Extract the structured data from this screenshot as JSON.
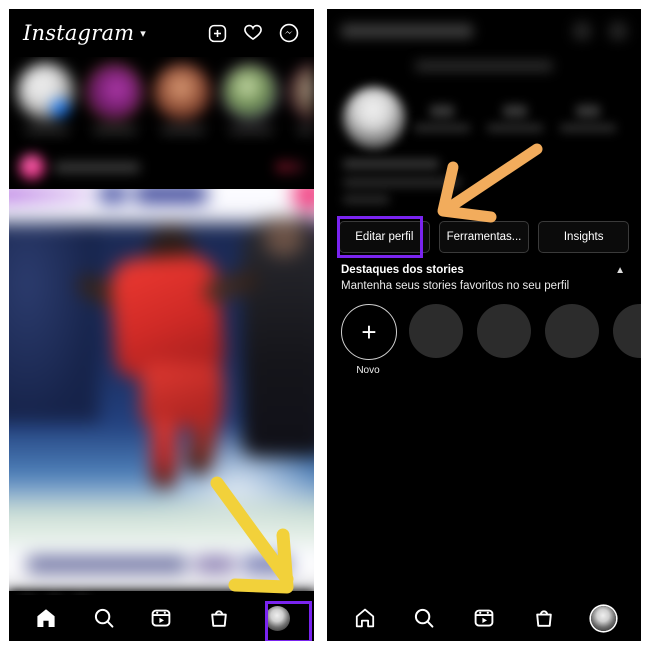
{
  "app": {
    "name": "Instagram",
    "language": "pt-BR"
  },
  "colors": {
    "highlight_box": "#7A24F0",
    "arrow_yellow": "#F2D13A",
    "arrow_orange": "#F2AC5C",
    "background": "#000000",
    "panel_border": "#ffffff"
  },
  "left_panel": {
    "name": "instagram-feed-screen",
    "header": {
      "logo_text": "Instagram",
      "logo_chevron": "chevron-down-icon",
      "icons": [
        "new-post-icon",
        "activity-heart-icon",
        "messenger-icon"
      ]
    },
    "stories": [
      {
        "label": "",
        "blurred": true
      },
      {
        "label": "",
        "blurred": true
      },
      {
        "label": "",
        "blurred": true
      },
      {
        "label": "",
        "blurred": true
      },
      {
        "label": "",
        "blurred": true
      }
    ],
    "post": {
      "author": "",
      "blurred": true,
      "image_description": "soccer player in red kit"
    },
    "annotation": {
      "arrow": "yellow-arrow-pointing-down-right",
      "target": "profile-tab"
    },
    "bottom_nav": [
      {
        "name": "home-icon",
        "label": "",
        "active": true
      },
      {
        "name": "search-icon",
        "label": "",
        "active": false
      },
      {
        "name": "reels-icon",
        "label": "",
        "active": false
      },
      {
        "name": "shop-icon",
        "label": "",
        "active": false
      },
      {
        "name": "profile-avatar-icon",
        "label": "",
        "active": false,
        "highlighted": true
      }
    ]
  },
  "right_panel": {
    "name": "instagram-profile-screen",
    "header": {
      "username": "",
      "icons": [
        "add-icon",
        "menu-icon"
      ],
      "blurred": true
    },
    "subheader": {
      "text": "",
      "blurred": true
    },
    "stats": [
      {
        "value": "",
        "label": "",
        "blurred": true
      },
      {
        "value": "",
        "label": "",
        "blurred": true
      },
      {
        "value": "",
        "label": "",
        "blurred": true
      }
    ],
    "bio": {
      "name": "",
      "line1": "",
      "line2": "",
      "blurred": true
    },
    "buttons": [
      {
        "label": "Editar perfil",
        "highlighted": true
      },
      {
        "label": "Ferramentas...",
        "highlighted": false
      },
      {
        "label": "Insights",
        "highlighted": false
      }
    ],
    "highlights": {
      "title": "Destaques dos stories",
      "subtitle": "Mantenha seus stories favoritos no seu perfil",
      "collapse_icon": "chevron-up-icon",
      "new_label": "Novo",
      "new_icon": "plus-icon",
      "placeholder_count": 4
    },
    "annotation": {
      "arrow": "orange-arrow-pointing-down-left",
      "target": "editar-perfil-button"
    },
    "bottom_nav": [
      {
        "name": "home-icon",
        "label": "",
        "active": false
      },
      {
        "name": "search-icon",
        "label": "",
        "active": false
      },
      {
        "name": "reels-icon",
        "label": "",
        "active": false
      },
      {
        "name": "shop-icon",
        "label": "",
        "active": false
      },
      {
        "name": "profile-avatar-icon",
        "label": "",
        "active": true
      }
    ]
  }
}
